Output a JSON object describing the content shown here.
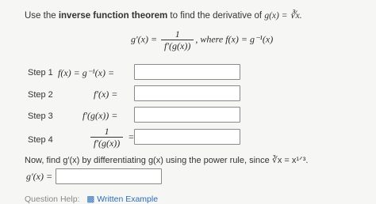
{
  "prompt": {
    "before": "Use the ",
    "bold": "inverse function theorem",
    "after": " to find the derivative of ",
    "function_expr": "g(x) = ∛x."
  },
  "theorem": {
    "lhs": "g′(x) =",
    "numerator": "1",
    "denominator": "f′(g(x))",
    "where_text": ", where f(x) = g⁻¹(x)"
  },
  "steps": [
    {
      "label": "Step 1",
      "expr": "f(x) = g⁻¹(x) ="
    },
    {
      "label": "Step 2",
      "expr": "f′(x) ="
    },
    {
      "label": "Step 3",
      "expr": "f′(g(x)) ="
    },
    {
      "label": "Step 4",
      "numerator": "1",
      "denominator": "f′(g(x))",
      "eq": "="
    }
  ],
  "final": {
    "instruction": "Now, find g′(x) by differentiating g(x) using the power rule, since ∛x = x¹ᐟ³.",
    "label": "g′(x) ="
  },
  "help": {
    "label": "Question Help:",
    "link": "Written Example"
  }
}
